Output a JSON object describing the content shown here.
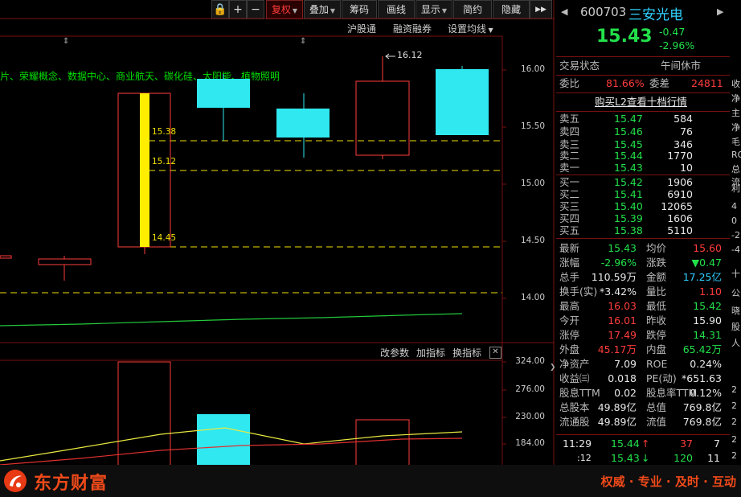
{
  "toolbar": {
    "lock": "🔒",
    "plus": "+",
    "minus": "−",
    "fuquan": "复权",
    "diejia": "叠加",
    "chouma": "筹码",
    "huaxian": "画线",
    "xianshi": "显示",
    "jianyue": "简约",
    "yincang": "隐藏"
  },
  "subtoolbar": {
    "hgt": "沪股通",
    "rzrq": "融资融券",
    "ma": "设置均线"
  },
  "concepts": "片、荣耀概念、数据中心、商业航天、碳化硅、太阳能、植物照明",
  "kline": {
    "high_marker": "16.12",
    "levels": [
      "15.38",
      "15.12",
      "14.45"
    ],
    "yaxis": [
      "16.00",
      "15.50",
      "15.00",
      "14.50",
      "14.00"
    ]
  },
  "volume": {
    "tools": [
      "改参数",
      "加指标",
      "换指标"
    ],
    "yaxis": [
      "324.00",
      "276.00",
      "230.00",
      "184.00"
    ]
  },
  "stock": {
    "code": "600703",
    "name": "三安光电",
    "price": "15.43",
    "change": "-0.47",
    "change_pct": "-2.96%",
    "status_label": "交易状态",
    "status": "午间休市",
    "weibi_label": "委比",
    "weibi": "81.66%",
    "weicha_label": "委差",
    "weicha": "24811",
    "l2_link": "购买L2查看十档行情"
  },
  "asks": [
    {
      "label": "卖五",
      "price": "15.47",
      "vol": "584"
    },
    {
      "label": "卖四",
      "price": "15.46",
      "vol": "76"
    },
    {
      "label": "卖三",
      "price": "15.45",
      "vol": "346"
    },
    {
      "label": "卖二",
      "price": "15.44",
      "vol": "1770"
    },
    {
      "label": "卖一",
      "price": "15.43",
      "vol": "10"
    }
  ],
  "bids": [
    {
      "label": "买一",
      "price": "15.42",
      "vol": "1906"
    },
    {
      "label": "买二",
      "price": "15.41",
      "vol": "6910"
    },
    {
      "label": "买三",
      "price": "15.40",
      "vol": "12065"
    },
    {
      "label": "买四",
      "price": "15.39",
      "vol": "1606"
    },
    {
      "label": "买五",
      "price": "15.38",
      "vol": "5110"
    }
  ],
  "stats": [
    {
      "l1": "最新",
      "v1": "15.43",
      "c1": "green",
      "l2": "均价",
      "v2": "15.60",
      "c2": "red"
    },
    {
      "l1": "涨幅",
      "v1": "-2.96%",
      "c1": "green",
      "l2": "涨跌",
      "v2": "▼0.47",
      "c2": "green"
    },
    {
      "l1": "总手",
      "v1": "110.59万",
      "c1": "white",
      "l2": "金额",
      "v2": "17.25亿",
      "c2": "cyan"
    },
    {
      "l1": "换手(实)",
      "v1": "*3.42%",
      "c1": "white",
      "l2": "量比",
      "v2": "1.10",
      "c2": "red"
    },
    {
      "l1": "最高",
      "v1": "16.03",
      "c1": "red",
      "l2": "最低",
      "v2": "15.42",
      "c2": "green"
    },
    {
      "l1": "今开",
      "v1": "16.01",
      "c1": "red",
      "l2": "昨收",
      "v2": "15.90",
      "c2": "white"
    },
    {
      "l1": "涨停",
      "v1": "17.49",
      "c1": "red",
      "l2": "跌停",
      "v2": "14.31",
      "c2": "green"
    },
    {
      "l1": "外盘",
      "v1": "45.17万",
      "c1": "red",
      "l2": "内盘",
      "v2": "65.42万",
      "c2": "green"
    },
    {
      "l1": "净资产",
      "v1": "7.09",
      "c1": "white",
      "l2": "ROE",
      "v2": "0.24%",
      "c2": "white"
    },
    {
      "l1": "收益㈢",
      "v1": "0.018",
      "c1": "white",
      "l2": "PE(动)",
      "v2": "*651.63",
      "c2": "white"
    },
    {
      "l1": "股息TTM",
      "v1": "0.02",
      "c1": "white",
      "l2": "股息率TTM",
      "v2": "0.12%",
      "c2": "white"
    },
    {
      "l1": "总股本",
      "v1": "49.89亿",
      "c1": "white",
      "l2": "总值",
      "v2": "769.8亿",
      "c2": "white"
    },
    {
      "l1": "流通股",
      "v1": "49.89亿",
      "c1": "white",
      "l2": "流值",
      "v2": "769.8亿",
      "c2": "white"
    }
  ],
  "ticks": [
    {
      "time": "11:29",
      "price": "15.44",
      "arrow": "↑",
      "vol": "37",
      "n": "7"
    },
    {
      "time": ":12",
      "price": "15.43",
      "arrow": "↓",
      "vol": "120",
      "n": "11"
    }
  ],
  "strip": [
    "收",
    "净",
    "主",
    "净",
    "毛",
    "RO",
    "总",
    "流",
    "利",
    "4",
    "0",
    "-2",
    "-4",
    "十",
    "公",
    "晓",
    "股",
    "人",
    "2",
    "2",
    "2",
    "2",
    "2"
  ],
  "brand": {
    "name": "东方财富",
    "slogan": "权威 · 专业 · 及时 · 互动"
  },
  "colors": {
    "up": "#ff3c3c",
    "down": "#22e04a",
    "accent": "#2fd0ff",
    "brand": "#f04a1a"
  }
}
